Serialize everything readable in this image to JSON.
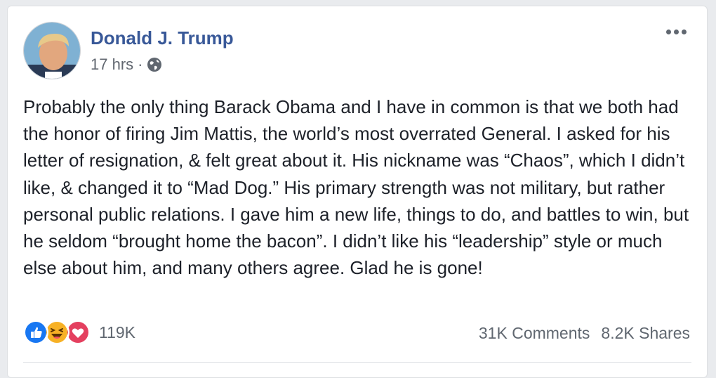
{
  "post": {
    "author": "Donald J. Trump",
    "time": "17 hrs",
    "separator": "·",
    "privacy_icon": "globe-icon",
    "menu_icon": "more-icon",
    "text": "Probably the only thing Barack Obama and I have in common is that we both had the honor of firing Jim Mattis, the world’s most overrated General. I asked for his letter of resignation, & felt great about it. His nickname was “Chaos”, which I didn’t like, & changed it to “Mad Dog.” His primary strength was not military, but rather personal public relations. I gave him a new life, things to do, and battles to win, but he seldom “brought home the bacon”. I didn’t like his “leadership” style or much else about him, and many others agree. Glad he is gone!"
  },
  "footer": {
    "reaction_icons": [
      "like-icon",
      "haha-icon",
      "love-icon"
    ],
    "reaction_count": "119K",
    "comments": "31K Comments",
    "shares": "8.2K Shares"
  },
  "colors": {
    "author_link": "#385898",
    "like": "#1877f2",
    "haha": "#f7b125",
    "love": "#e4405f"
  }
}
